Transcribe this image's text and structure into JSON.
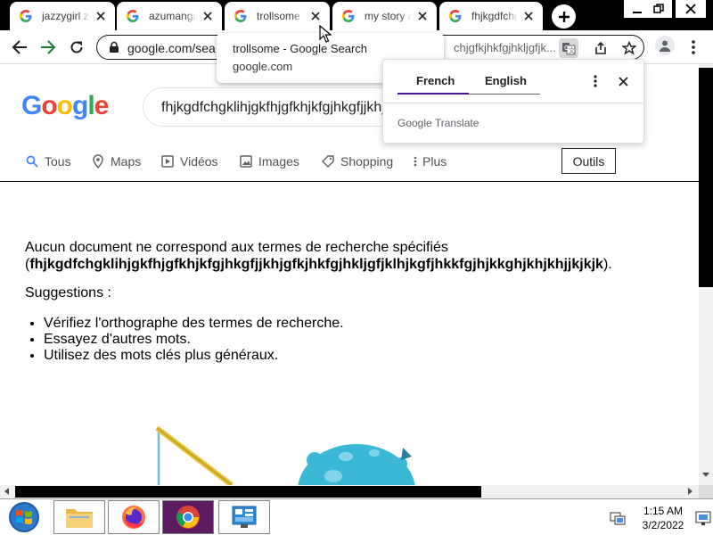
{
  "tabs": [
    {
      "title": "jazzygirl ze"
    },
    {
      "title": "azumanga"
    },
    {
      "title": "trollsome"
    },
    {
      "title": "my story a"
    },
    {
      "title": "fhjkgdfchg"
    }
  ],
  "address": {
    "url": "google.com/sea",
    "url_tail": "chjgfkjhkfgjhkljgfjk..."
  },
  "tooltip": {
    "title": "trollsome - Google Search",
    "url": "google.com"
  },
  "translate": {
    "tab_french": "French",
    "tab_english": "English",
    "brand": "Google Translate"
  },
  "search": {
    "query": "fhjkgdfchgklihjgkfhjgfkhjkfgjhkgfjjkhjgfkjhkfgjhkljgfjklhjkgfjhkkfgjhjkkghjkhjkhjjkjkjk"
  },
  "logo": "Google",
  "nav": {
    "tous": "Tous",
    "maps": "Maps",
    "videos": "Vidéos",
    "images": "Images",
    "shopping": "Shopping",
    "plus": "Plus",
    "outils": "Outils"
  },
  "results": {
    "no_match_text": "Aucun document ne correspond aux termes de recherche spécifiés",
    "open_paren": "(",
    "query_bold": "fhjkgdfchgklihjgkfhjgfkhjkfgjhkgfjjkhjgfkjhkfgjhkljgfjklhjkgfjhkkfgjhjkkghjkhjkhjjkjkjk",
    "close_paren": ").",
    "suggestions_title": "Suggestions :",
    "suggestions": [
      "Vérifiez l'orthographe des termes de recherche.",
      "Essayez d'autres mots.",
      "Utilisez des mots clés plus généraux."
    ]
  },
  "taskbar": {
    "time": "1:15 AM",
    "date": "3/2/2022"
  },
  "colors": {
    "g_blue": "#4285F4",
    "g_red": "#EA4335",
    "g_yellow": "#FBBC05",
    "g_green": "#34A853",
    "active_taskbar": "#5a1b63"
  }
}
